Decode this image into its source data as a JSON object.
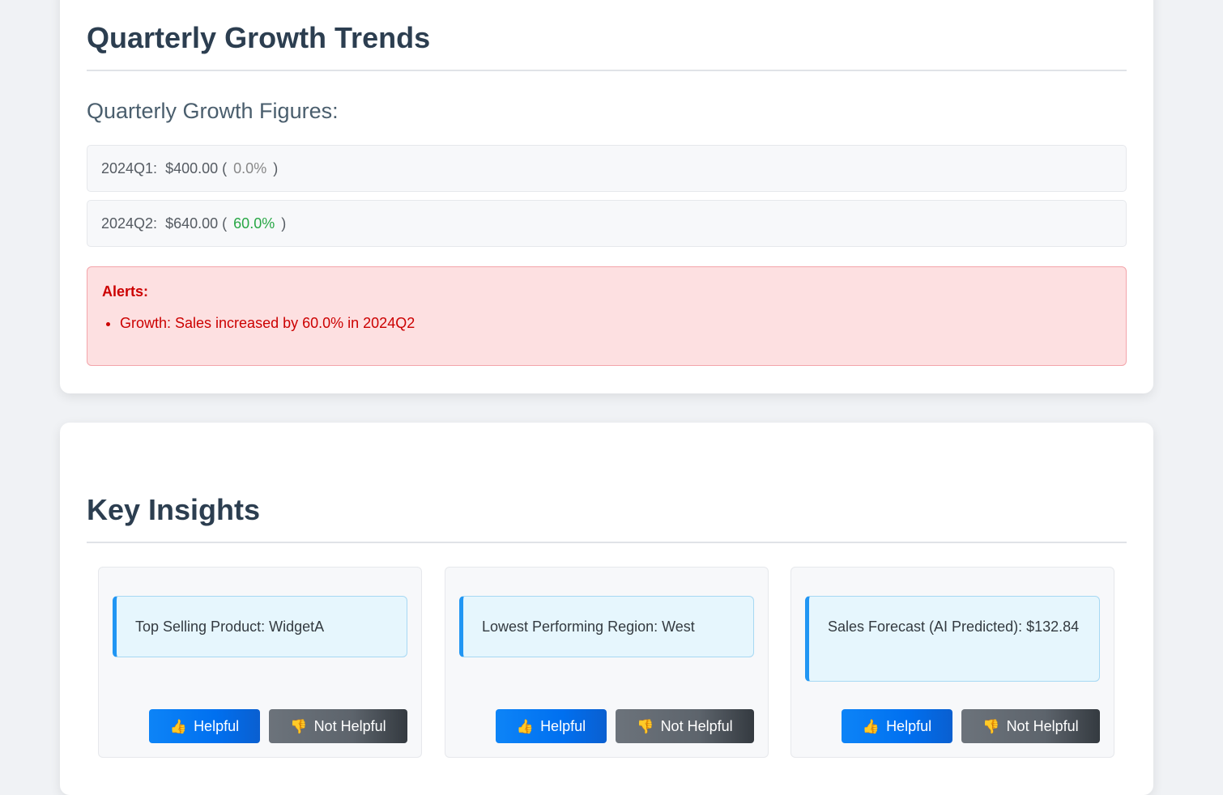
{
  "growth_section": {
    "title": "Quarterly Growth Trends",
    "subtitle": "Quarterly Growth Figures:",
    "rows": [
      {
        "quarter": "2024Q1:",
        "amount": "$400.00",
        "open": "(",
        "growth": "0.0%",
        "close": ")",
        "trend": "neutral",
        "color": "#888888"
      },
      {
        "quarter": "2024Q2:",
        "amount": "$640.00",
        "open": "(",
        "growth": "60.0%",
        "close": ")",
        "trend": "positive",
        "color": "#28a745"
      }
    ],
    "alerts": {
      "title": "Alerts:",
      "items": [
        "Growth: Sales increased by 60.0% in 2024Q2"
      ],
      "color": "#cc0000",
      "background": "#fde0e1"
    }
  },
  "insights_section": {
    "title": "Key Insights",
    "cards": [
      {
        "text": "Top Selling Product: WidgetA",
        "helpful_label": "Helpful",
        "not_helpful_label": "Not Helpful"
      },
      {
        "text": "Lowest Performing Region: West",
        "helpful_label": "Helpful",
        "not_helpful_label": "Not Helpful"
      },
      {
        "text": "Sales Forecast (AI Predicted): $132.84",
        "helpful_label": "Helpful",
        "not_helpful_label": "Not Helpful"
      }
    ],
    "icons": {
      "helpful": "thumbs-up-icon",
      "not_helpful": "thumbs-down-icon"
    },
    "accent_color": "#2196f3",
    "helpful_button_color": "#0070f0",
    "not_helpful_button_color": "#5d646c"
  }
}
